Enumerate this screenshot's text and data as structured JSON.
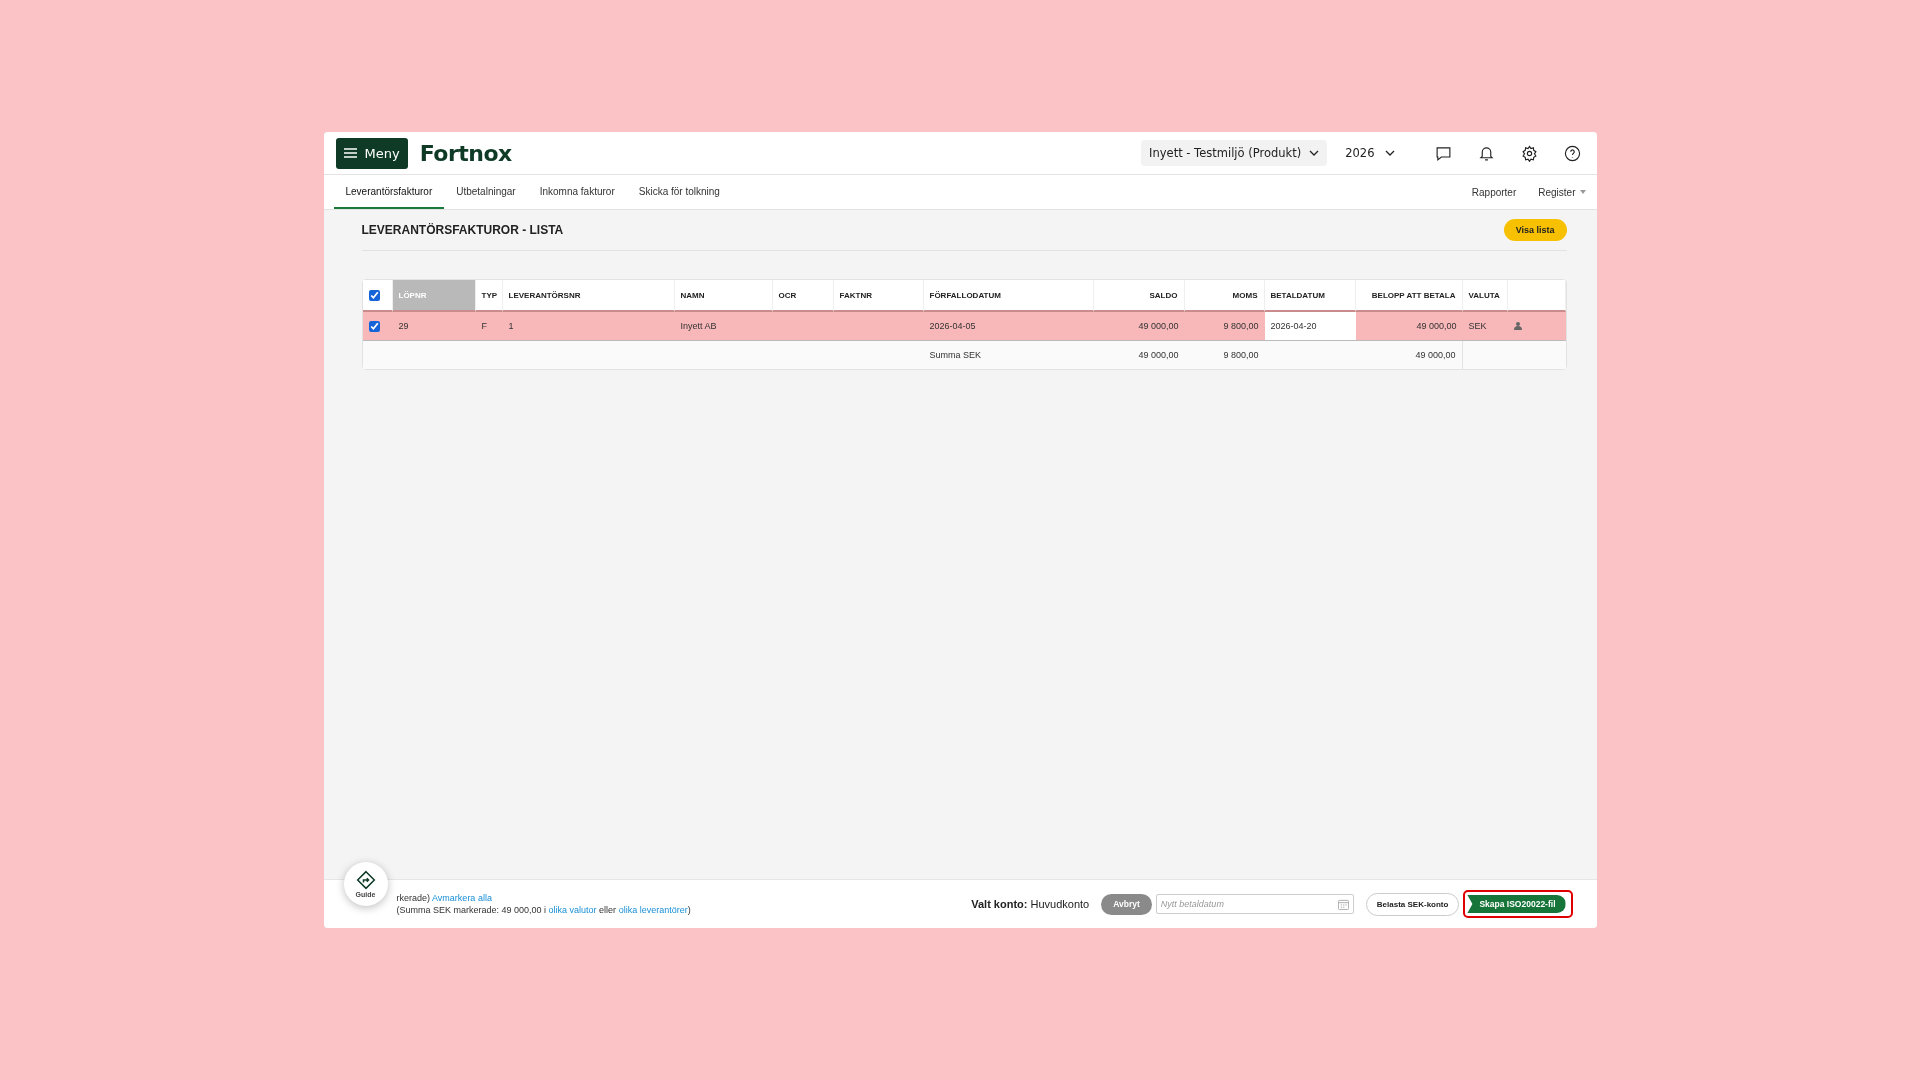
{
  "header": {
    "menu_label": "Meny",
    "logo": "Fortnox",
    "company": "Inyett - Testmiljö (Produkt)",
    "year": "2026"
  },
  "tabs": [
    {
      "label": "Leverantörsfakturor",
      "selected": true
    },
    {
      "label": "Utbetalningar",
      "selected": false
    },
    {
      "label": "Inkomna fakturor",
      "selected": false
    },
    {
      "label": "Skicka för tolkning",
      "selected": false
    }
  ],
  "right_links": [
    {
      "label": "Rapporter",
      "dropdown": false
    },
    {
      "label": "Register",
      "dropdown": true
    }
  ],
  "page_title": "LEVERANTÖRSFAKTUROR - LISTA",
  "view_button": "Visa lista",
  "table": {
    "all_checked": true,
    "columns": [
      {
        "label": "LÖPNR",
        "sorted": true
      },
      {
        "label": "TYP",
        "sorted": false
      },
      {
        "label": "LEVERANTÖRSNR",
        "sorted": false
      },
      {
        "label": "NAMN",
        "sorted": false
      },
      {
        "label": "OCR",
        "sorted": false
      },
      {
        "label": "FAKTNR",
        "sorted": false
      },
      {
        "label": "FÖRFALLODATUM",
        "sorted": false
      },
      {
        "label": "SALDO",
        "sorted": false
      },
      {
        "label": "MOMS",
        "sorted": false
      },
      {
        "label": "BETALDATUM",
        "sorted": false
      },
      {
        "label": "BELOPP ATT BETALA",
        "sorted": false
      },
      {
        "label": "VALUTA",
        "sorted": false
      }
    ],
    "rows": [
      {
        "checked": true,
        "selected": true,
        "lopnr": "29",
        "typ": "F",
        "leverantorsnr": "1",
        "namn": "Inyett AB",
        "forfallodatum": "2026-04-05",
        "saldo": "49 000,00",
        "moms": "9 800,00",
        "betaldatum": "2026-04-20",
        "belopp": "49 000,00",
        "valuta": "SEK"
      }
    ],
    "totals": {
      "label": "Summa SEK",
      "saldo": "49 000,00",
      "moms": "9 800,00",
      "belopp": "49 000,00"
    }
  },
  "footer": {
    "guide_label": "Guide",
    "selection_line": [
      {
        "text": "rkerade)",
        "link": false
      },
      {
        "text": "Avmarkera alla",
        "link": true
      }
    ],
    "summary_line": [
      {
        "text": "(Summa SEK markerade: 49 000,00 i ",
        "link": false
      },
      {
        "text": "olika valutor",
        "link": true
      },
      {
        "text": " eller ",
        "link": false
      },
      {
        "text": "olika leverantörer",
        "link": true
      },
      {
        "text": ")",
        "link": false
      }
    ],
    "account": "**Valt konto:** Huvudkonto",
    "cancel_button": "Avbryt",
    "date_field": {
      "placeholder": "Nytt betaldatum"
    },
    "charge_button": "Belasta SEK-konto",
    "create_button": {
      "label": "Skapa ISO20022-fil",
      "highlighted": true
    }
  }
}
